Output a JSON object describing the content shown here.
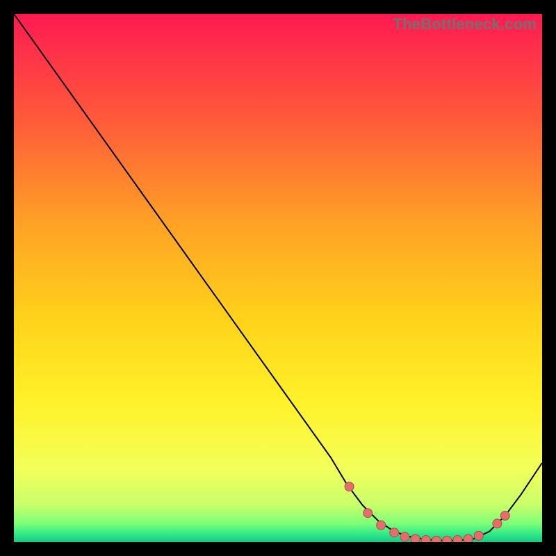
{
  "watermark": "TheBottleneck.com",
  "colors": {
    "frame": "#000000",
    "curve": "#000000",
    "marker_fill": "#e36e6b",
    "marker_stroke": "#b34b48"
  },
  "chart_data": {
    "type": "line",
    "title": "",
    "xlabel": "",
    "ylabel": "",
    "xlim": [
      0,
      100
    ],
    "ylim": [
      0,
      100
    ],
    "grid": false,
    "legend": false,
    "gradient_stops": [
      {
        "offset": 0.0,
        "color": "#ff1a52"
      },
      {
        "offset": 0.2,
        "color": "#ff5a3a"
      },
      {
        "offset": 0.4,
        "color": "#ffa325"
      },
      {
        "offset": 0.58,
        "color": "#ffd31a"
      },
      {
        "offset": 0.74,
        "color": "#fff22a"
      },
      {
        "offset": 0.86,
        "color": "#f4ff5a"
      },
      {
        "offset": 0.93,
        "color": "#c8ff6a"
      },
      {
        "offset": 0.965,
        "color": "#7dff78"
      },
      {
        "offset": 0.985,
        "color": "#2fe987"
      },
      {
        "offset": 1.0,
        "color": "#17c884"
      }
    ],
    "series": [
      {
        "name": "bottleneck-curve",
        "x": [
          0,
          5,
          10,
          15,
          20,
          25,
          30,
          35,
          40,
          45,
          50,
          55,
          60,
          63,
          66,
          69,
          72,
          75,
          78,
          81,
          84,
          87,
          90,
          93,
          96,
          100
        ],
        "y": [
          100,
          93,
          86,
          79,
          72,
          65,
          58,
          51,
          44,
          37,
          30,
          23,
          16,
          11,
          7,
          4,
          2,
          1,
          0.5,
          0.3,
          0.3,
          0.6,
          2,
          5,
          9,
          15
        ]
      }
    ],
    "markers": {
      "series": "bottleneck-curve",
      "points": [
        {
          "x": 63.5,
          "y": 10.5
        },
        {
          "x": 67,
          "y": 5.5
        },
        {
          "x": 69.5,
          "y": 3.2
        },
        {
          "x": 72,
          "y": 1.8
        },
        {
          "x": 74,
          "y": 1.0
        },
        {
          "x": 76,
          "y": 0.6
        },
        {
          "x": 78,
          "y": 0.4
        },
        {
          "x": 80,
          "y": 0.3
        },
        {
          "x": 82,
          "y": 0.3
        },
        {
          "x": 84,
          "y": 0.4
        },
        {
          "x": 86,
          "y": 0.6
        },
        {
          "x": 88,
          "y": 1.2
        },
        {
          "x": 91.5,
          "y": 3.5
        },
        {
          "x": 93,
          "y": 5.0
        }
      ]
    }
  }
}
